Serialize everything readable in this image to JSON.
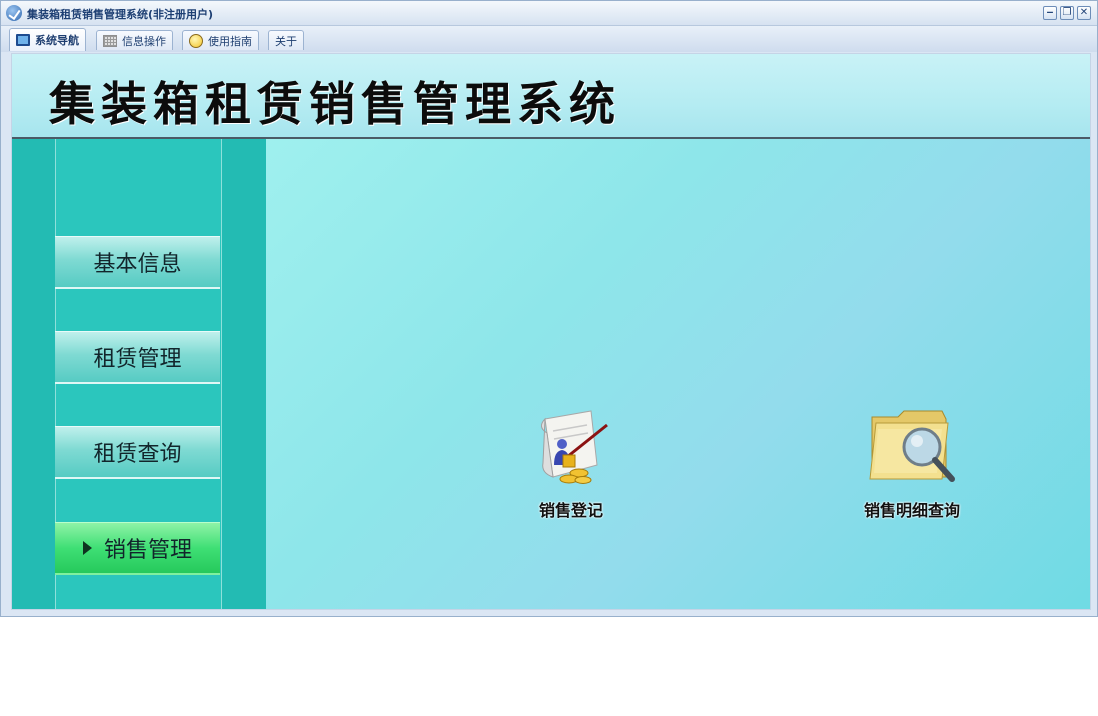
{
  "window": {
    "title": "集装箱租赁销售管理系统(非注册用户)",
    "controls": {
      "minimize": "‒",
      "restore": "❐",
      "close": "✕"
    }
  },
  "tabs": [
    {
      "label": "系统导航",
      "icon": "monitor-icon",
      "active": true
    },
    {
      "label": "信息操作",
      "icon": "grid-icon",
      "active": false
    },
    {
      "label": "使用指南",
      "icon": "lightbulb-icon",
      "active": false
    },
    {
      "label": "关于",
      "icon": "",
      "active": false
    }
  ],
  "banner": {
    "title": "集装箱租赁销售管理系统"
  },
  "sidebar": {
    "items": [
      {
        "label": "基本信息",
        "active": false
      },
      {
        "label": "租赁管理",
        "active": false
      },
      {
        "label": "租赁查询",
        "active": false
      },
      {
        "label": "销售管理",
        "active": true
      }
    ]
  },
  "content": {
    "functions": [
      {
        "label": "销售登记",
        "icon": "sales-register-icon"
      },
      {
        "label": "销售明细查询",
        "icon": "folder-search-icon"
      }
    ]
  },
  "colors": {
    "sidebar_bg": "#23bbb3",
    "active_item": "#3fdf75",
    "banner_bg": "#b5ecf2",
    "content_bg": "#8ee6ea"
  }
}
